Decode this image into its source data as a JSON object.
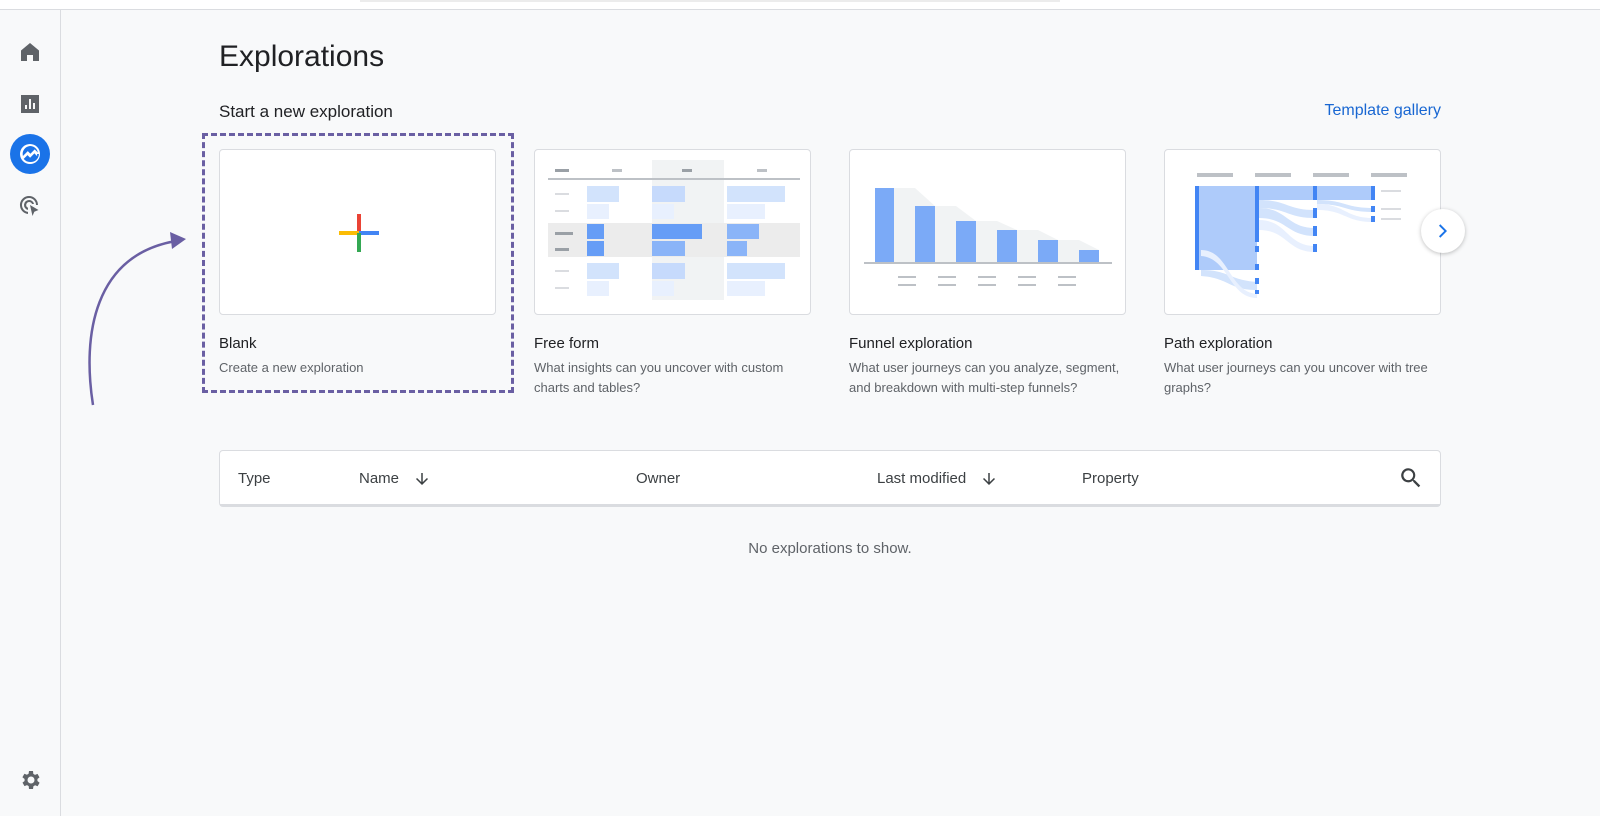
{
  "sidebar": {
    "items": [
      {
        "name": "home",
        "icon": "home-icon"
      },
      {
        "name": "reports",
        "icon": "bar-chart-icon"
      },
      {
        "name": "explore",
        "icon": "explore-icon",
        "active": true
      },
      {
        "name": "advertising",
        "icon": "target-cursor-icon"
      }
    ],
    "settings_icon": "gear-icon"
  },
  "header": {
    "title": "Explorations"
  },
  "new_exploration": {
    "section_title": "Start a new exploration",
    "template_gallery_label": "Template gallery",
    "cards": [
      {
        "name": "Blank",
        "description": "Create a new exploration"
      },
      {
        "name": "Free form",
        "description": "What insights can you uncover with custom charts and tables?"
      },
      {
        "name": "Funnel exploration",
        "description": "What user journeys can you analyze, segment, and breakdown with multi-step funnels?"
      },
      {
        "name": "Path exploration",
        "description": "What user journeys can you uncover with tree graphs?"
      }
    ]
  },
  "table": {
    "columns": {
      "type": "Type",
      "name": "Name",
      "owner": "Owner",
      "last_modified": "Last modified",
      "property": "Property"
    },
    "empty_message": "No explorations to show."
  },
  "colors": {
    "accent": "#1a73e8",
    "annotation": "#6a5fa3"
  }
}
